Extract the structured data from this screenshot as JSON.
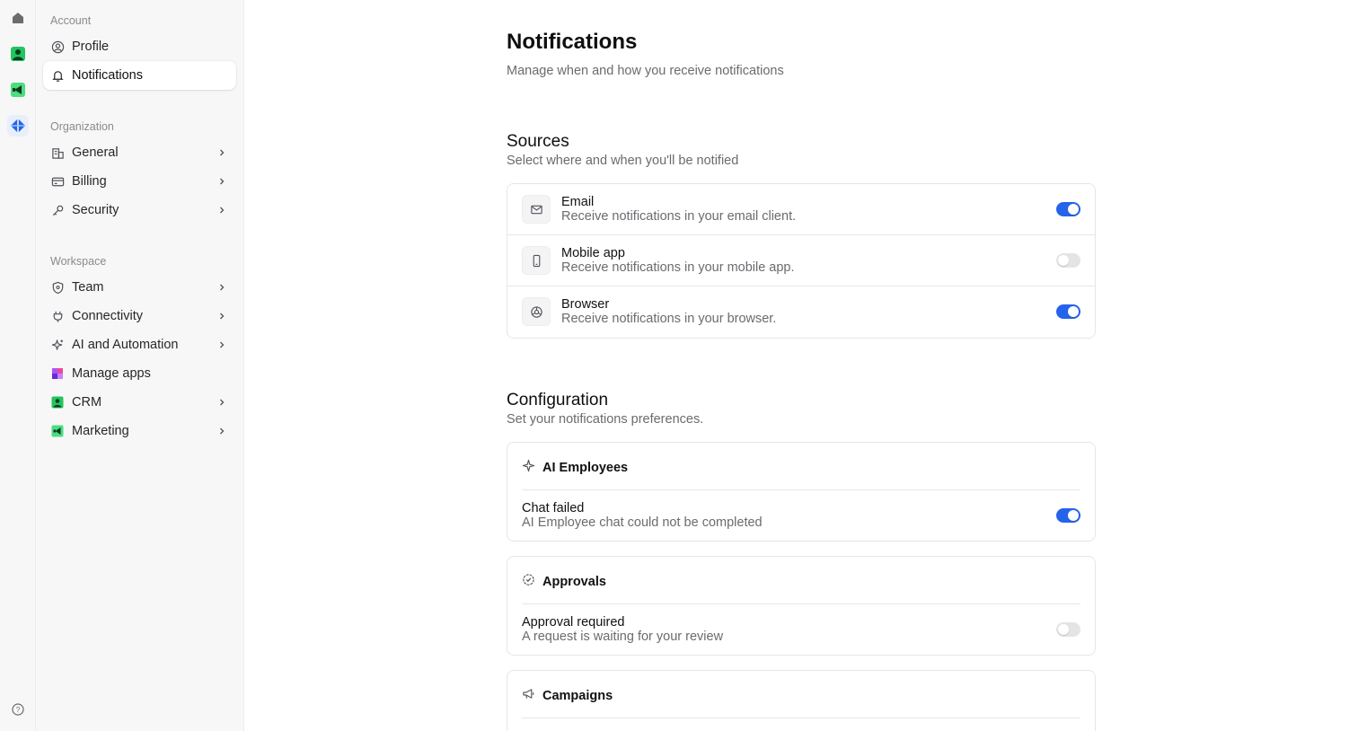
{
  "rail": {
    "icons": [
      "home-icon",
      "crm-app-icon",
      "marketing-app-icon",
      "workspace-app-icon",
      "help-icon"
    ]
  },
  "sidebar": {
    "groups": [
      {
        "title": "Account",
        "items": [
          {
            "label": "Profile",
            "icon": "user-circle-icon",
            "chevron": false,
            "active": false
          },
          {
            "label": "Notifications",
            "icon": "bell-icon",
            "chevron": false,
            "active": true
          }
        ]
      },
      {
        "title": "Organization",
        "items": [
          {
            "label": "General",
            "icon": "building-icon",
            "chevron": true
          },
          {
            "label": "Billing",
            "icon": "credit-card-icon",
            "chevron": true
          },
          {
            "label": "Security",
            "icon": "key-icon",
            "chevron": true
          }
        ]
      },
      {
        "title": "Workspace",
        "items": [
          {
            "label": "Team",
            "icon": "shield-icon",
            "chevron": true
          },
          {
            "label": "Connectivity",
            "icon": "plug-icon",
            "chevron": true
          },
          {
            "label": "AI and Automation",
            "icon": "sparkle-icon",
            "chevron": true
          },
          {
            "label": "Manage apps",
            "icon": "apps-grid-icon",
            "chevron": false
          },
          {
            "label": "CRM",
            "icon": "crm-app-icon",
            "chevron": true
          },
          {
            "label": "Marketing",
            "icon": "marketing-app-icon",
            "chevron": true
          }
        ]
      }
    ]
  },
  "main": {
    "title": "Notifications",
    "subtitle": "Manage when and how you receive notifications",
    "sources": {
      "title": "Sources",
      "subtitle": "Select where and when you'll be notified",
      "rows": [
        {
          "title": "Email",
          "description": "Receive notifications in your email client.",
          "enabled": true,
          "icon": "mail-icon"
        },
        {
          "title": "Mobile app",
          "description": "Receive notifications in your mobile app.",
          "enabled": false,
          "icon": "mobile-icon"
        },
        {
          "title": "Browser",
          "description": "Receive notifications in your browser.",
          "enabled": true,
          "icon": "browser-icon"
        }
      ]
    },
    "configuration": {
      "title": "Configuration",
      "subtitle": "Set your notifications preferences.",
      "cards": [
        {
          "title": "AI Employees",
          "icon": "sparkle-icon",
          "item": {
            "title": "Chat failed",
            "description": "AI Employee chat could not be completed",
            "enabled": true
          }
        },
        {
          "title": "Approvals",
          "icon": "check-badge-icon",
          "item": {
            "title": "Approval required",
            "description": "A request is waiting for your review",
            "enabled": false
          }
        },
        {
          "title": "Campaigns",
          "icon": "megaphone-icon"
        }
      ]
    }
  },
  "colors": {
    "accent": "#2563eb",
    "toggle_off": "#e4e4e7",
    "crm_green": "#22c55e",
    "workspace_blue": "#2563eb"
  }
}
